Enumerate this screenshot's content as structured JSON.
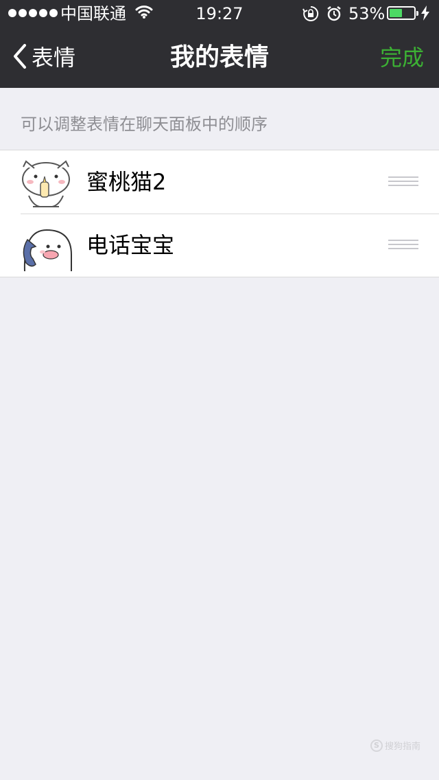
{
  "status_bar": {
    "carrier": "中国联通",
    "time": "19:27",
    "battery_percent_label": "53%",
    "battery_level": 0.53,
    "battery_color": "#4cd964",
    "icons": [
      "signal-dots-icon",
      "wifi-icon",
      "rotation-lock-icon",
      "alarm-icon",
      "battery-icon",
      "charging-bolt-icon"
    ]
  },
  "nav": {
    "back_label": "表情",
    "title": "我的表情",
    "done_label": "完成",
    "done_color": "#3cb034"
  },
  "hint": "可以调整表情在聊天面板中的顺序",
  "sticker_packs": [
    {
      "name": "蜜桃猫2",
      "thumbnail": "peach-cat-sticker-icon"
    },
    {
      "name": "电话宝宝",
      "thumbnail": "phone-baby-sticker-icon"
    }
  ],
  "watermark": "搜狗指南"
}
